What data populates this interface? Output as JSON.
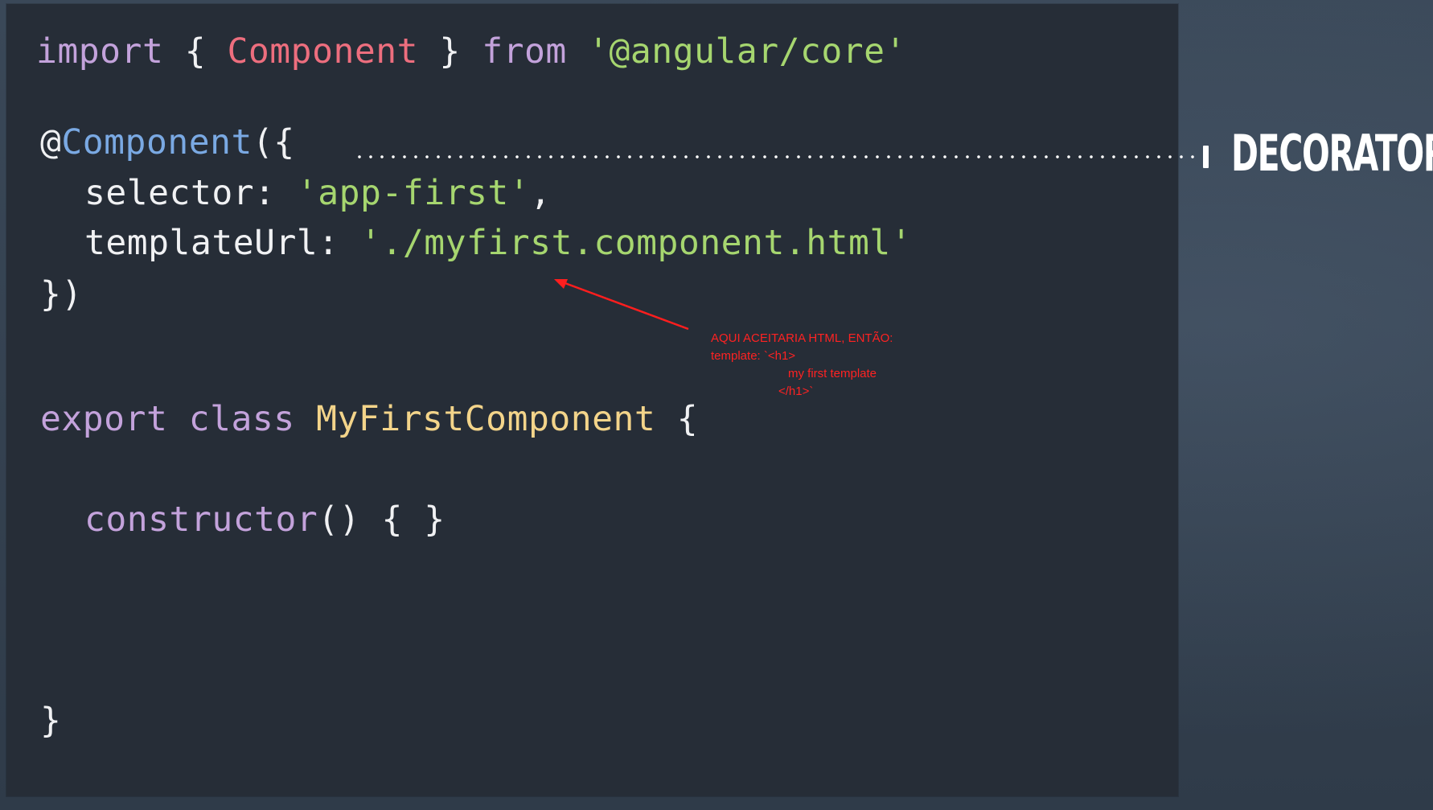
{
  "code": {
    "line1": {
      "kw_import": "import",
      "brace_open": "{",
      "name": "Component",
      "brace_close": "}",
      "kw_from": "from",
      "module": "'@angular/core'"
    },
    "line2": {
      "at": "@",
      "decorator": "Component",
      "open": "({"
    },
    "line3": {
      "key": "selector:",
      "value": "'app-first'",
      "comma": ","
    },
    "line4": {
      "key": "templateUrl:",
      "value": "'./myfirst.component.html'"
    },
    "line5": {
      "close": "})"
    },
    "line6": {
      "kw_export": "export",
      "kw_class": "class",
      "class_name": "MyFirstComponent",
      "brace_open": "{"
    },
    "line7": {
      "ctor": "constructor",
      "rest": "() { }"
    },
    "line8": {
      "close": "}"
    }
  },
  "callout": {
    "label": "DECORATOR"
  },
  "annotation": {
    "line1": "AQUI ACEITARIA HTML, ENTÃO:",
    "line2": "template: `<h1>",
    "line3": "my first template",
    "line4": "</h1>`"
  },
  "colors": {
    "keyword": "#c3a2db",
    "import_name": "#ed6e7e",
    "string": "#a6d66f",
    "decorator": "#7aa9e3",
    "class_name": "#f3d48a",
    "annotation": "#ff2222",
    "panel_bg": "#262d37",
    "slide_bg": "#33404f"
  }
}
